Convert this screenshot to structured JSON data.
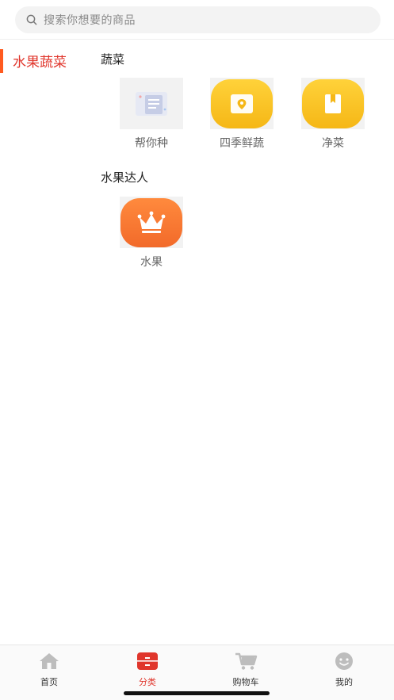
{
  "search": {
    "placeholder": "搜索你想要的商品",
    "icon": "search-icon"
  },
  "sidebar": {
    "items": [
      {
        "label": "水果蔬菜",
        "active": true
      }
    ]
  },
  "sections": [
    {
      "title": "蔬菜",
      "items": [
        {
          "label": "帮你种",
          "icon": "document-placeholder-icon"
        },
        {
          "label": "四季鲜蔬",
          "icon": "map-location-icon"
        },
        {
          "label": "净菜",
          "icon": "book-icon"
        }
      ]
    },
    {
      "title": "水果达人",
      "items": [
        {
          "label": "水果",
          "icon": "crown-icon"
        }
      ]
    }
  ],
  "tabbar": {
    "tabs": [
      {
        "label": "首页",
        "icon": "home-icon"
      },
      {
        "label": "分类",
        "icon": "category-icon",
        "active": true
      },
      {
        "label": "购物车",
        "icon": "cart-icon"
      },
      {
        "label": "我的",
        "icon": "smiley-icon"
      }
    ]
  },
  "colors": {
    "accent": "#e0352b",
    "indicator": "#ff5a1f",
    "yellow": "#f8c423",
    "orange": "#f27631"
  }
}
